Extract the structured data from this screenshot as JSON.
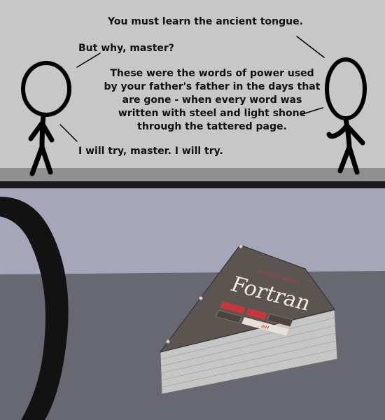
{
  "dialogue": {
    "line1": "You must learn the ancient tongue.",
    "line2": "But why, master?",
    "line3": "These were the words of power used by your father's father in the days that are gone - when every word was written with steel and light shone through the tattered page.",
    "line4": "I will try, master. I will try."
  },
  "book": {
    "title": "Fortran",
    "tagline": "REFERENCE MANUAL",
    "label_center": "IBM"
  },
  "colors": {
    "top_background": "#c7c7c7",
    "floor": "#8f8f8f",
    "bottom_wall": "#a6a6ba",
    "bottom_floor": "#686873",
    "book_cover": "#5b5450",
    "book_pages": "#c9c9c9",
    "accent_red": "#c5373a"
  }
}
